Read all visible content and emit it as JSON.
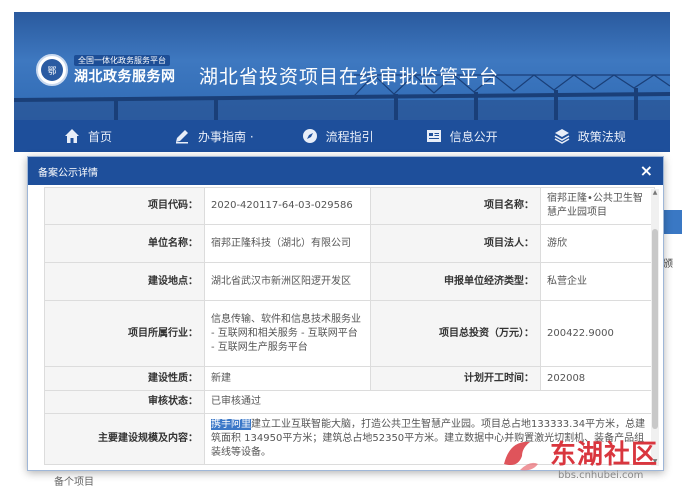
{
  "header": {
    "logo_small": "全国一体化政务服务平台",
    "logo_big": "湖北政务服务网",
    "site_title": "湖北省投资项目在线审批监管平台"
  },
  "nav": {
    "items": [
      {
        "label": "首页",
        "icon": "home-icon"
      },
      {
        "label": "办事指南 ·",
        "icon": "pen-icon"
      },
      {
        "label": "流程指引",
        "icon": "compass-icon"
      },
      {
        "label": "信息公开",
        "icon": "document-icon"
      },
      {
        "label": "政策法规",
        "icon": "layers-icon"
      }
    ]
  },
  "modal": {
    "title": "备案公示详情",
    "close": "×"
  },
  "details": {
    "project_code_label": "项目代码：",
    "project_code": "2020-420117-64-03-029586",
    "project_name_label": "项目名称：",
    "project_name": "宿邦正隆•公共卫生智慧产业园项目",
    "unit_name_label": "单位名称：",
    "unit_name": "宿邦正隆科技（湖北）有限公司",
    "legal_person_label": "项目法人：",
    "legal_person": "游欣",
    "location_label": "建设地点：",
    "location": "湖北省武汉市新洲区阳逻开发区",
    "unit_type_label": "申报单位经济类型：",
    "unit_type": "私营企业",
    "industry_label": "项目所属行业：",
    "industry": "信息传输、软件和信息技术服务业 - 互联网和相关服务 - 互联网平台 - 互联网生产服务平台",
    "investment_label": "项目总投资（万元）：",
    "investment": "200422.9000",
    "nature_label": "建设性质：",
    "nature": "新建",
    "start_time_label": "计划开工时间：",
    "start_time": "202008",
    "audit_label": "审核状态：",
    "audit": "已审核通过",
    "scale_label": "主要建设规模及内容：",
    "scale_highlight": "携手阿里",
    "scale_rest": "建立工业互联智能大脑，打造公共卫生智慧产业园。项目总占地133333.34平方米，总建筑面积 134950平方米；建筑总占地52350平方米。建立数据中心并购置激光切割机、装备产品组装线等设备。"
  },
  "background": {
    "side_text": "颁",
    "bottom_text": "备个项目"
  },
  "watermark": {
    "brand": "东湖社区",
    "url": "bbs.cnhubei.com"
  },
  "colors": {
    "nav_bg": "#1e4f9b",
    "banner_bg": "#3e78c0",
    "highlight": "#3b78c8",
    "watermark_red": "#d9363e"
  }
}
